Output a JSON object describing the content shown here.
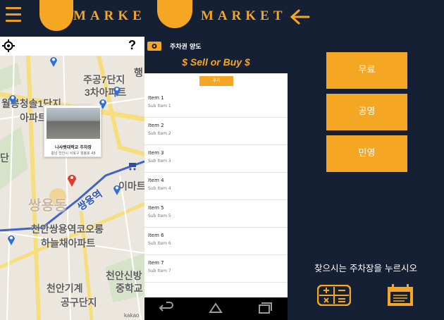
{
  "left_panel": {
    "logo_text": "MARKET",
    "help_label": "?",
    "map_labels": {
      "jugong7": "주공7단지",
      "apt3": "3차아파트",
      "haeng": "행",
      "wolbong": "월봉청솔1단지",
      "apateu": "아파트",
      "dan": "단",
      "imart": "이마트",
      "ssangyong_station": "쌍용역",
      "ssangyong_dong": "쌍용동",
      "cheonan_ssangyong": "천안쌍용역코오롱",
      "haneul": "하늘채아파트",
      "cheonan_sinbang": "천안신방",
      "junghakgyo": "중학교",
      "cheonan_gigye": "천안기계",
      "gonggu": "공구단지",
      "kakao": "kakao"
    },
    "popup": {
      "title": "나사렛대학교 주차장",
      "address": "충남 천안시 서북구 월봉로 48"
    },
    "colors": {
      "navy": "#152035",
      "accent": "#f5a623",
      "pin_blue": "#2f6fd8",
      "pin_red": "#e23b2e"
    }
  },
  "middle_panel": {
    "logo_text": "MARKET",
    "title": "주차권 양도",
    "banner": "$ Sell or Buy $",
    "add_button": "추가",
    "items": [
      {
        "title": "Item 1",
        "sub": "Sub Item 1"
      },
      {
        "title": "Item 2",
        "sub": "Sub Item 2"
      },
      {
        "title": "Item 3",
        "sub": "Sub Item 3"
      },
      {
        "title": "Item 4",
        "sub": "Sub Item 4"
      },
      {
        "title": "Item 5",
        "sub": "Sub Item 5"
      },
      {
        "title": "Item 6",
        "sub": "Sub Item 6"
      },
      {
        "title": "Item 7",
        "sub": "Sub Item 7"
      }
    ]
  },
  "right_panel": {
    "options": [
      "무료",
      "공영",
      "민영"
    ],
    "hint": "찾으시는 주차장을 누르시오"
  }
}
